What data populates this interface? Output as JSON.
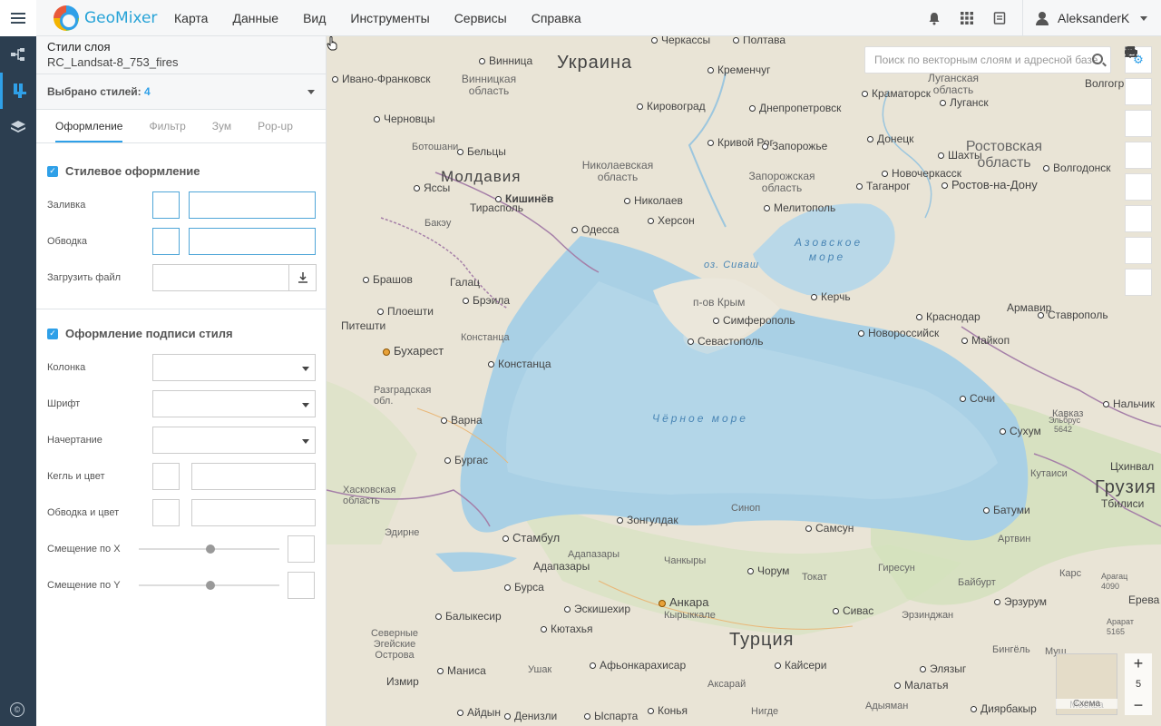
{
  "header": {
    "logo": "GeoMixer",
    "menu": [
      "Карта",
      "Данные",
      "Вид",
      "Инструменты",
      "Сервисы",
      "Справка"
    ],
    "user": "AleksanderK"
  },
  "panel": {
    "title": "Стили слоя",
    "layer": "RC_Landsat-8_753_fires",
    "styles_label": "Выбрано стилей:",
    "styles_count": "4",
    "tabs": [
      "Оформление",
      "Фильтр",
      "Зум",
      "Pop-up"
    ],
    "style_section": "Стилевое оформление",
    "fill": "Заливка",
    "stroke": "Обводка",
    "upload": "Загрузить файл",
    "label_section": "Оформление подписи стиля",
    "column": "Колонка",
    "font": "Шрифт",
    "style": "Начертание",
    "size_color": "Кегль и цвет",
    "halo_color": "Обводка и цвет",
    "offset_x": "Смещение по X",
    "offset_y": "Смещение по Y"
  },
  "map": {
    "search_placeholder": "Поиск по векторным слоям и адресной базе",
    "zoom_level": "5",
    "minimap_city": "Москва",
    "minimap_label": "Схема",
    "countries": {
      "ukraine": "Украина",
      "moldova": "Молдавия",
      "turkey": "Турция",
      "georgia": "Грузия"
    },
    "seas": {
      "black": "Чёрное море",
      "azov": "Азовское море",
      "sivash": "оз. Сиваш"
    },
    "regions": {
      "vinnitsa": "Винницкая область",
      "nikolaev": "Николаевская область",
      "zaporozhye": "Запорожская область",
      "rostov": "Ростовская область",
      "lugansk": "Луганская область",
      "crimea": "п-ов Крым"
    },
    "cities": {
      "cherkassy": "Черкассы",
      "poltava": "Полтава",
      "vinnitsa": "Винница",
      "kremenchug": "Кременчуг",
      "ivano": "Ивано-Франковск",
      "kirovograd": "Кировоград",
      "dnepro": "Днепропетровск",
      "kramatorsk": "Краматорск",
      "lugansk": "Луганск",
      "volgograd": "Волгогр",
      "chernovtsy": "Черновцы",
      "krivoy": "Кривой Рог",
      "zaporozhye": "Запорожье",
      "donetsk": "Донецк",
      "botoshani": "Ботошани",
      "beltsy": "Бельцы",
      "shakhty": "Шахты",
      "novocherkassk": "Новочеркасск",
      "volgodonsk": "Волгодонск",
      "yassy": "Яссы",
      "kishinev": "Кишинёв",
      "taganrog": "Таганрог",
      "rostov": "Ростов-на-Дону",
      "tiraspol": "Тирасполь",
      "nikolaev": "Николаев",
      "melitopol": "Мелитополь",
      "bakeu": "Бакэу",
      "kherson": "Херсон",
      "odessa": "Одесса",
      "brashov": "Брашов",
      "galats": "Галац",
      "braila": "Брэила",
      "kerch": "Керчь",
      "ploesti": "Плоешти",
      "simferopol": "Симферополь",
      "krasnodar": "Краснодар",
      "armavir": "Армавир",
      "stavropol": "Ставрополь",
      "pitesti": "Питешти",
      "novoross": "Новороссийск",
      "maykop": "Майкоп",
      "sevastopol": "Севастополь",
      "bucharest": "Бухарест",
      "konstantsa": "Констанца",
      "sochi": "Сочи",
      "nalchik": "Нальчик",
      "varna": "Варна",
      "sukhum": "Сухум",
      "burgas": "Бургас",
      "kutaisi": "Кутаиси",
      "tskhinval": "Цхинвал",
      "tbilisi": "Тбилиси",
      "zonguldak": "Зонгулдак",
      "sinop": "Синоп",
      "samsun": "Самсун",
      "batumi": "Батуми",
      "istanbul": "Стамбул",
      "adapazari": "Адапазары",
      "chankiry": "Чанкыры",
      "chorum": "Чорум",
      "tokat": "Токат",
      "giresun": "Гиресун",
      "artvin": "Артвин",
      "bursa": "Бурса",
      "bayburt": "Байбурт",
      "kars": "Карс",
      "eskisehir": "Эскишехир",
      "ankara": "Анкара",
      "kyrykkale": "Кырыккале",
      "sivas": "Сивас",
      "erzurum": "Эрзурум",
      "balikesir": "Балыкесир",
      "kutahya": "Кютахья",
      "erzincan": "Эрзинджан",
      "erevan": "Ерева",
      "manisa": "Маниса",
      "ushak": "Ушак",
      "afyon": "Афьонкарахисар",
      "kayseri": "Кайсери",
      "elazig": "Элязыг",
      "bingol": "Бингёль",
      "mush": "Муш",
      "izmir": "Измир",
      "aksaray": "Аксарай",
      "malatya": "Малатья",
      "aydyn": "Айдын",
      "denizli": "Денизли",
      "isparta": "Ыспарта",
      "konya": "Конья",
      "nigde": "Нигде",
      "adyaman": "Адыяман",
      "diyarbakir": "Диярбакыр",
      "varnaobl": "Разградская обл.",
      "khaskovo": "Хасковская область",
      "edirne": "Эдирне",
      "north": "Северные Эгейские Острова",
      "konstobl": "Констанца",
      "caucasus": "Кавказ",
      "elbrus": "Эльбрус 5642",
      "ararat": "Арарат 5165",
      "aragats": "Арагац 4090"
    }
  }
}
